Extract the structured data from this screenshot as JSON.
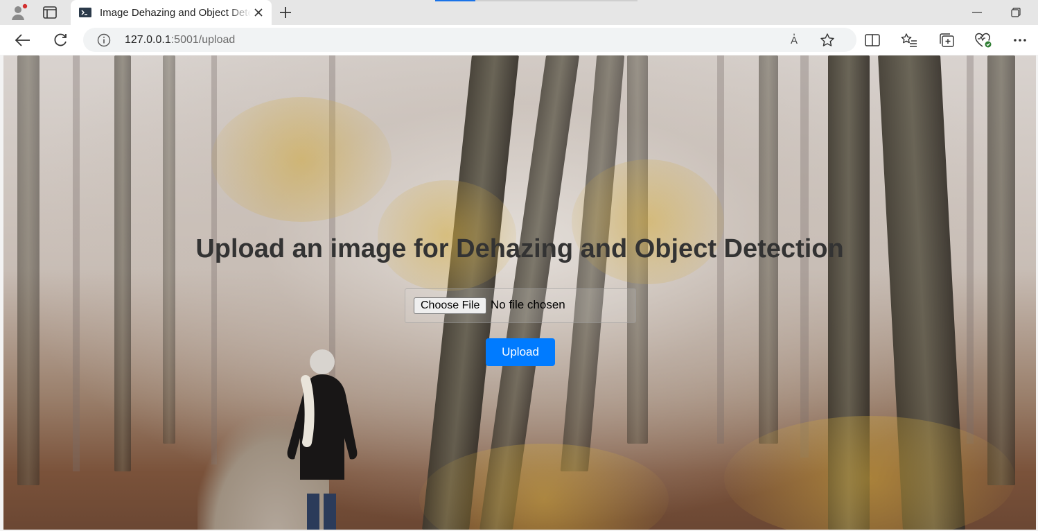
{
  "browser": {
    "tab_title": "Image Dehazing and Object Detection",
    "url_host": "127.0.0.1",
    "url_rest": ":5001/upload",
    "read_aloud_label": "A҆"
  },
  "page": {
    "heading": "Upload an image for Dehazing and Object Detection",
    "file_input": {
      "button_label": "Choose File",
      "status_text": "No file chosen"
    },
    "upload_button": "Upload"
  },
  "colors": {
    "accent": "#007bff",
    "heading": "#333333"
  },
  "icons": {
    "profile": "profile-avatar-icon",
    "tab_actions": "tab-actions-icon",
    "close": "close-icon",
    "new_tab": "plus-icon",
    "back": "back-arrow-icon",
    "reload": "reload-icon",
    "info": "info-icon",
    "favorite": "star-icon",
    "split": "split-screen-icon",
    "favorites": "favorites-list-icon",
    "collections": "collections-icon",
    "performance": "browser-essentials-icon",
    "more": "more-icon"
  }
}
